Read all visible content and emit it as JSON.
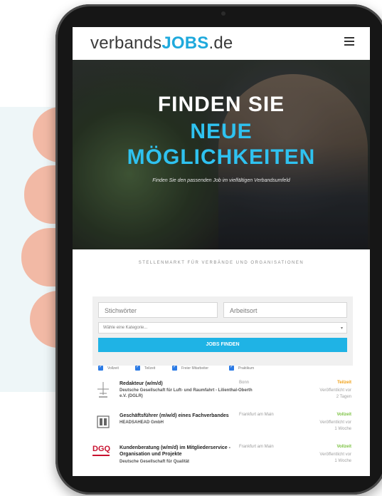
{
  "site": {
    "logo_text": "verbands",
    "logo_accent": "JOBS",
    "logo_suffix": ".de",
    "menu_icon": "hamburger-menu-icon"
  },
  "hero": {
    "line1": "FINDEN SIE",
    "line2": "NEUE",
    "line3": "MÖGLICHKEITEN",
    "subtitle": "Finden Sie den passenden Job im vielfältigen Verbandsumfeld"
  },
  "tagline": "STELLENMARKT FÜR VERBÄNDE UND ORGANISATIONEN",
  "search": {
    "keywords_placeholder": "Stichwörter",
    "location_placeholder": "Arbeitsort",
    "category_placeholder": "Wähle eine Kategorie...",
    "button_label": "JOBS FINDEN"
  },
  "filters": [
    {
      "label": "Vollzeit",
      "checked": true
    },
    {
      "label": "Teilzeit",
      "checked": true
    },
    {
      "label": "Freier Mitarbeiter",
      "checked": true
    },
    {
      "label": "Praktikum",
      "checked": true
    }
  ],
  "jobs": [
    {
      "title": "Redakteur (w/m/d)",
      "company": "Deutsche Gesellschaft für Luft- und Raumfahrt - Lilienthal-Oberth e.V. (DGLR)",
      "location": "Bonn",
      "type": "Teilzeit",
      "published_label": "Veröffentlicht vor",
      "published_ago": "2 Tagen",
      "logo_icon": "dglr-logo-icon"
    },
    {
      "title": "Geschäftsführer (m/w/d) eines Fachverbandes",
      "company": "HEADSAHEAD GmbH",
      "location": "Frankfurt am Main",
      "type": "Vollzeit",
      "published_label": "Veröffentlicht vor",
      "published_ago": "1 Woche",
      "logo_icon": "headsahead-logo-icon"
    },
    {
      "title": "Kundenberatung (w/m/d) im Mitgliederservice - Organisation und Projekte",
      "company": "Deutsche Gesellschaft für Qualität",
      "location": "Frankfurt am Main",
      "type": "Vollzeit",
      "published_label": "Veröffentlicht vor",
      "published_ago": "1 Woche",
      "logo_text": "DGQ",
      "logo_icon": "dgq-logo-icon"
    }
  ],
  "colors": {
    "accent": "#1fa9dc",
    "teilzeit": "#f0a015",
    "vollzeit": "#7cc242",
    "button": "#1fb3e5"
  }
}
